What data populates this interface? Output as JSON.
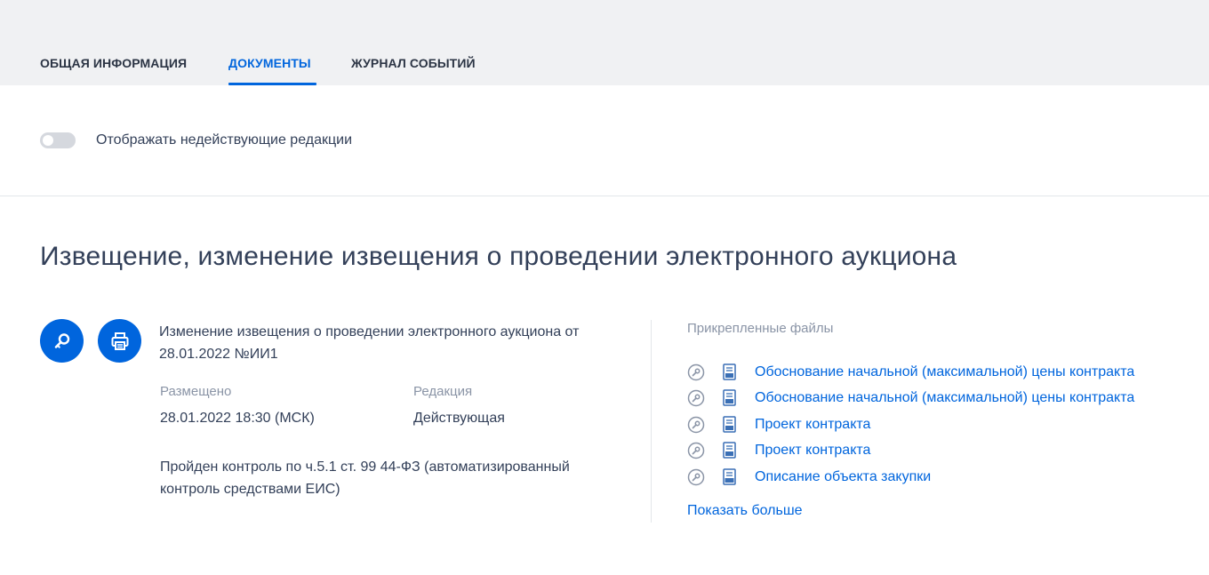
{
  "tabs": [
    {
      "label": "ОБЩАЯ ИНФОРМАЦИЯ",
      "active": false
    },
    {
      "label": "ДОКУМЕНТЫ",
      "active": true
    },
    {
      "label": "ЖУРНАЛ СОБЫТИЙ",
      "active": false
    }
  ],
  "toggle": {
    "label": "Отображать недействующие редакции",
    "checked": false
  },
  "section": {
    "title": "Извещение, изменение извещения о проведении электронного аукциона"
  },
  "document": {
    "title": "Изменение извещения о проведении электронного аукциона от 28.01.2022 №ИИ1",
    "placed_label": "Размещено",
    "placed_value": "28.01.2022 18:30 (МСК)",
    "edition_label": "Редакция",
    "edition_value": "Действующая",
    "control_note": "Пройден контроль по ч.5.1 ст. 99 44-ФЗ (автоматизированный контроль средствами ЕИС)"
  },
  "files": {
    "header": "Прикрепленные файлы",
    "items": [
      {
        "name": "Обоснование начальной (максимальной) цены контракта",
        "icon": "doc-file-icon"
      },
      {
        "name": "Обоснование начальной (максимальной) цены контракта",
        "icon": "doc-file-icon"
      },
      {
        "name": "Проект контракта",
        "icon": "doc-file-icon"
      },
      {
        "name": "Проект контракта",
        "icon": "doc-file-icon"
      },
      {
        "name": "Описание объекта закупки",
        "icon": "docx-file-icon"
      }
    ],
    "show_more": "Показать больше"
  },
  "colors": {
    "accent": "#0065dd",
    "text": "#334059",
    "muted": "#8a94a6",
    "tabs_bg": "#f0f1f3"
  }
}
